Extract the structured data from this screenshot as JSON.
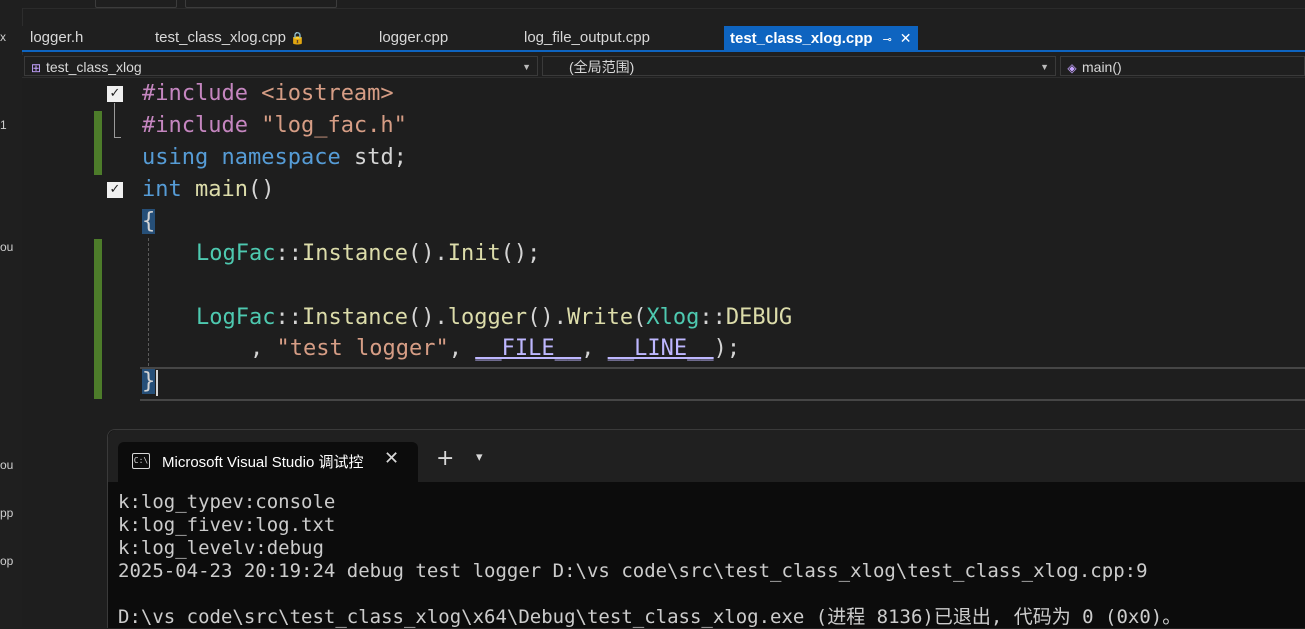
{
  "left_strip": {
    "items": [
      "x",
      "1",
      "ou",
      "ou",
      "pp",
      "op"
    ]
  },
  "tabs": [
    {
      "label": "logger.h"
    },
    {
      "label": "test_class_xlog.cpp",
      "lock": "🔒"
    },
    {
      "label": "logger.cpp"
    },
    {
      "label": "log_file_output.cpp"
    },
    {
      "label": "test_class_xlog.cpp",
      "active": true,
      "pin": "⊸",
      "close": "✕"
    }
  ],
  "navbar": {
    "project": "test_class_xlog",
    "scope": "(全局范围)",
    "member": "main()"
  },
  "code": {
    "l1": [
      "#include",
      " ",
      "<iostream>"
    ],
    "l2": [
      "#include",
      " ",
      "\"log_fac.h\""
    ],
    "l3": [
      "using",
      " ",
      "namespace",
      " std;"
    ],
    "l4": [
      "int",
      " ",
      "main",
      "()"
    ],
    "l5": "{",
    "l6": [
      "LogFac",
      "::",
      "Instance",
      "().",
      "Init",
      "();"
    ],
    "l8": [
      "LogFac",
      "::",
      "Instance",
      "().",
      "logger",
      "().",
      "Write",
      "(",
      "Xlog",
      "::",
      "DEBUG"
    ],
    "l9": [
      ", ",
      "\"test logger\"",
      ", ",
      "__FILE__",
      ", ",
      "__LINE__",
      ");"
    ],
    "l10": "}"
  },
  "console": {
    "tab_title": "Microsoft Visual Studio 调试控",
    "icon_text": "C:\\",
    "close": "✕",
    "plus": "+",
    "chevron": "⌄",
    "lines": [
      "k:log_typev:console",
      "k:log_fivev:log.txt",
      "k:log_levelv:debug",
      "2025-04-23 20:19:24 debug test logger D:\\vs code\\src\\test_class_xlog\\test_class_xlog.cpp:9",
      "",
      "D:\\vs code\\src\\test_class_xlog\\x64\\Debug\\test_class_xlog.exe (进程 8136)已退出, 代码为 0 (0x0)。"
    ]
  },
  "colors": {
    "accent": "#0e64c0",
    "keyword": "#569cd6",
    "string": "#d69d85",
    "type": "#4ec9b0",
    "function": "#dcdcaa",
    "macro": "#beb7ff",
    "changed_margin": "#4d7c2a"
  },
  "icons": {
    "fold": "collapse-box-icon",
    "class": "class-icon",
    "method": "cube-icon",
    "console": "console-icon"
  }
}
